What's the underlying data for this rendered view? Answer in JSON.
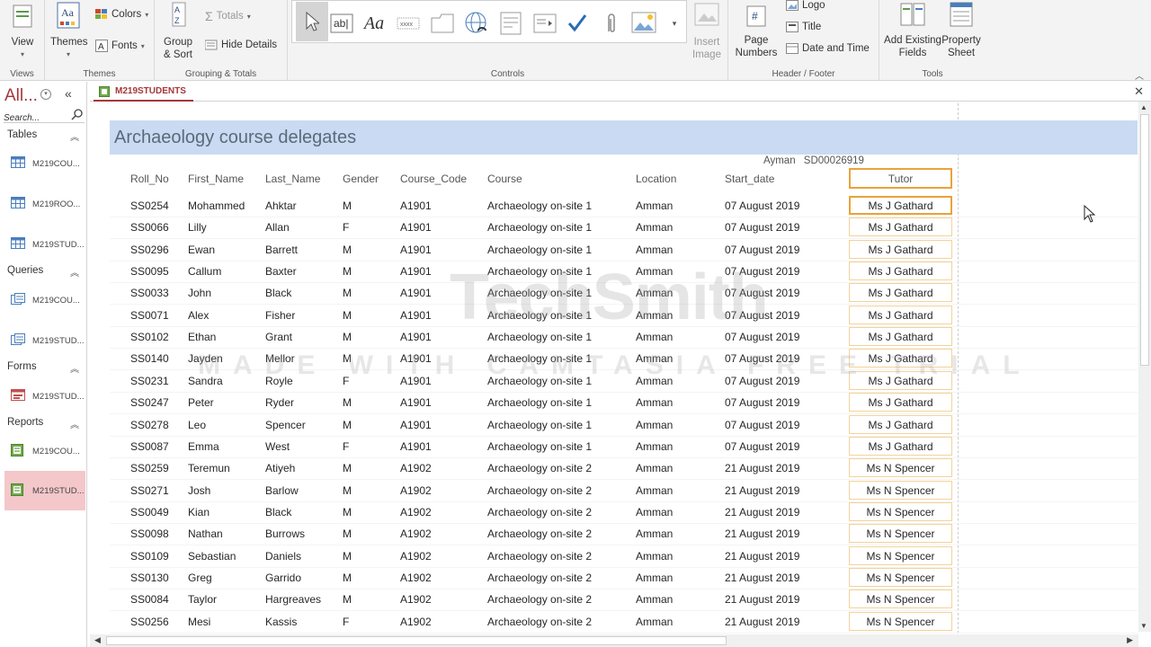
{
  "ribbon": {
    "views": {
      "view_label": "View",
      "group_label": "Views"
    },
    "themes": {
      "themes_label": "Themes",
      "colors_label": "Colors",
      "fonts_label": "Fonts",
      "group_label": "Themes"
    },
    "grouping": {
      "group_sort_label": "Group\n& Sort",
      "totals_label": "Totals",
      "hide_details_label": "Hide Details",
      "group_label": "Grouping & Totals"
    },
    "controls": {
      "group_label": "Controls",
      "insert_image_label": "Insert\nImage"
    },
    "header_footer": {
      "page_numbers_label": "Page\nNumbers",
      "logo_label": "Logo",
      "title_label": "Title",
      "date_time_label": "Date and Time",
      "group_label": "Header / Footer"
    },
    "tools": {
      "add_fields_label": "Add Existing\nFields",
      "property_sheet_label": "Property\nSheet",
      "group_label": "Tools"
    }
  },
  "nav": {
    "title": "All...",
    "search_placeholder": "Search...",
    "sections": [
      {
        "label": "Tables",
        "items": [
          "M219COU...",
          "M219ROO...",
          "M219STUD..."
        ]
      },
      {
        "label": "Queries",
        "items": [
          "M219COU...",
          "M219STUD..."
        ]
      },
      {
        "label": "Forms",
        "items": [
          "M219STUD..."
        ]
      },
      {
        "label": "Reports",
        "items": [
          "M219COU...",
          "M219STUD..."
        ]
      }
    ]
  },
  "tab": {
    "label": "M219STUDENTS"
  },
  "report": {
    "title": "Archaeology course delegates",
    "meta_name": "Ayman",
    "meta_id": "SD00026919",
    "columns": [
      "Roll_No",
      "First_Name",
      "Last_Name",
      "Gender",
      "Course_Code",
      "Course",
      "Location",
      "Start_date",
      "Tutor"
    ],
    "rows": [
      [
        "SS0254",
        "Mohammed",
        "Ahktar",
        "M",
        "A1901",
        "Archaeology on-site 1",
        "Amman",
        "07 August 2019",
        "Ms J Gathard"
      ],
      [
        "SS0066",
        "Lilly",
        "Allan",
        "F",
        "A1901",
        "Archaeology on-site 1",
        "Amman",
        "07 August 2019",
        "Ms J Gathard"
      ],
      [
        "SS0296",
        "Ewan",
        "Barrett",
        "M",
        "A1901",
        "Archaeology on-site 1",
        "Amman",
        "07 August 2019",
        "Ms J Gathard"
      ],
      [
        "SS0095",
        "Callum",
        "Baxter",
        "M",
        "A1901",
        "Archaeology on-site 1",
        "Amman",
        "07 August 2019",
        "Ms J Gathard"
      ],
      [
        "SS0033",
        "John",
        "Black",
        "M",
        "A1901",
        "Archaeology on-site 1",
        "Amman",
        "07 August 2019",
        "Ms J Gathard"
      ],
      [
        "SS0071",
        "Alex",
        "Fisher",
        "M",
        "A1901",
        "Archaeology on-site 1",
        "Amman",
        "07 August 2019",
        "Ms J Gathard"
      ],
      [
        "SS0102",
        "Ethan",
        "Grant",
        "M",
        "A1901",
        "Archaeology on-site 1",
        "Amman",
        "07 August 2019",
        "Ms J Gathard"
      ],
      [
        "SS0140",
        "Jayden",
        "Mellor",
        "M",
        "A1901",
        "Archaeology on-site 1",
        "Amman",
        "07 August 2019",
        "Ms J Gathard"
      ],
      [
        "SS0231",
        "Sandra",
        "Royle",
        "F",
        "A1901",
        "Archaeology on-site 1",
        "Amman",
        "07 August 2019",
        "Ms J Gathard"
      ],
      [
        "SS0247",
        "Peter",
        "Ryder",
        "M",
        "A1901",
        "Archaeology on-site 1",
        "Amman",
        "07 August 2019",
        "Ms J Gathard"
      ],
      [
        "SS0278",
        "Leo",
        "Spencer",
        "M",
        "A1901",
        "Archaeology on-site 1",
        "Amman",
        "07 August 2019",
        "Ms J Gathard"
      ],
      [
        "SS0087",
        "Emma",
        "West",
        "F",
        "A1901",
        "Archaeology on-site 1",
        "Amman",
        "07 August 2019",
        "Ms J Gathard"
      ],
      [
        "SS0259",
        "Teremun",
        "Atiyeh",
        "M",
        "A1902",
        "Archaeology on-site 2",
        "Amman",
        "21 August 2019",
        "Ms N Spencer"
      ],
      [
        "SS0271",
        "Josh",
        "Barlow",
        "M",
        "A1902",
        "Archaeology on-site 2",
        "Amman",
        "21 August 2019",
        "Ms N Spencer"
      ],
      [
        "SS0049",
        "Kian",
        "Black",
        "M",
        "A1902",
        "Archaeology on-site 2",
        "Amman",
        "21 August 2019",
        "Ms N Spencer"
      ],
      [
        "SS0098",
        "Nathan",
        "Burrows",
        "M",
        "A1902",
        "Archaeology on-site 2",
        "Amman",
        "21 August 2019",
        "Ms N Spencer"
      ],
      [
        "SS0109",
        "Sebastian",
        "Daniels",
        "M",
        "A1902",
        "Archaeology on-site 2",
        "Amman",
        "21 August 2019",
        "Ms N Spencer"
      ],
      [
        "SS0130",
        "Greg",
        "Garrido",
        "M",
        "A1902",
        "Archaeology on-site 2",
        "Amman",
        "21 August 2019",
        "Ms N Spencer"
      ],
      [
        "SS0084",
        "Taylor",
        "Hargreaves",
        "M",
        "A1902",
        "Archaeology on-site 2",
        "Amman",
        "21 August 2019",
        "Ms N Spencer"
      ],
      [
        "SS0256",
        "Mesi",
        "Kassis",
        "F",
        "A1902",
        "Archaeology on-site 2",
        "Amman",
        "21 August 2019",
        "Ms N Spencer"
      ]
    ]
  },
  "watermark": {
    "line1": "TechSmith",
    "line2": "MADE WITH CAMTASIA FREE TRIAL"
  },
  "colors": {
    "accent": "#a4373a",
    "header_band": "#c9daf2",
    "selection": "#e8a33a"
  }
}
